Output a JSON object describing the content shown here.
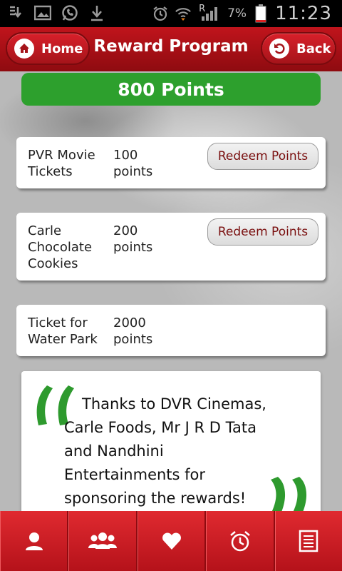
{
  "status_bar": {
    "left_icons": [
      "download-icon",
      "image-icon",
      "whatsapp-icon",
      "download-arrow-icon"
    ],
    "right_icons": [
      "alarm-icon",
      "wifi-icon",
      "signal-icon",
      "battery-icon"
    ],
    "roaming": "R",
    "battery_percent": "7%",
    "time": "11:23"
  },
  "header": {
    "home_label": "Home",
    "title": "Reward Program",
    "back_label": "Back"
  },
  "points": {
    "label": "800 Points"
  },
  "rewards": [
    {
      "name": "PVR Movie Tickets",
      "points": "100 points",
      "button": "Redeem Points"
    },
    {
      "name": "Carle Chocolate Cookies",
      "points": "200 points",
      "button": "Redeem Points"
    },
    {
      "name": "Ticket for Water Park",
      "points": "2000 points"
    }
  ],
  "quote": {
    "text": "Thanks to DVR Cinemas, Carle Foods, Mr J R D Tata and Nandhini Entertainments for sponsoring the rewards!"
  },
  "bottom_nav": [
    {
      "icon": "profile-icon"
    },
    {
      "icon": "group-icon"
    },
    {
      "icon": "heart-icon"
    },
    {
      "icon": "alarm-clock-icon"
    },
    {
      "icon": "list-icon"
    }
  ],
  "colors": {
    "header_red": "#c0141c",
    "points_green": "#2da02d",
    "redeem_text": "#7a1010",
    "quote_green": "#2e9a2e"
  }
}
